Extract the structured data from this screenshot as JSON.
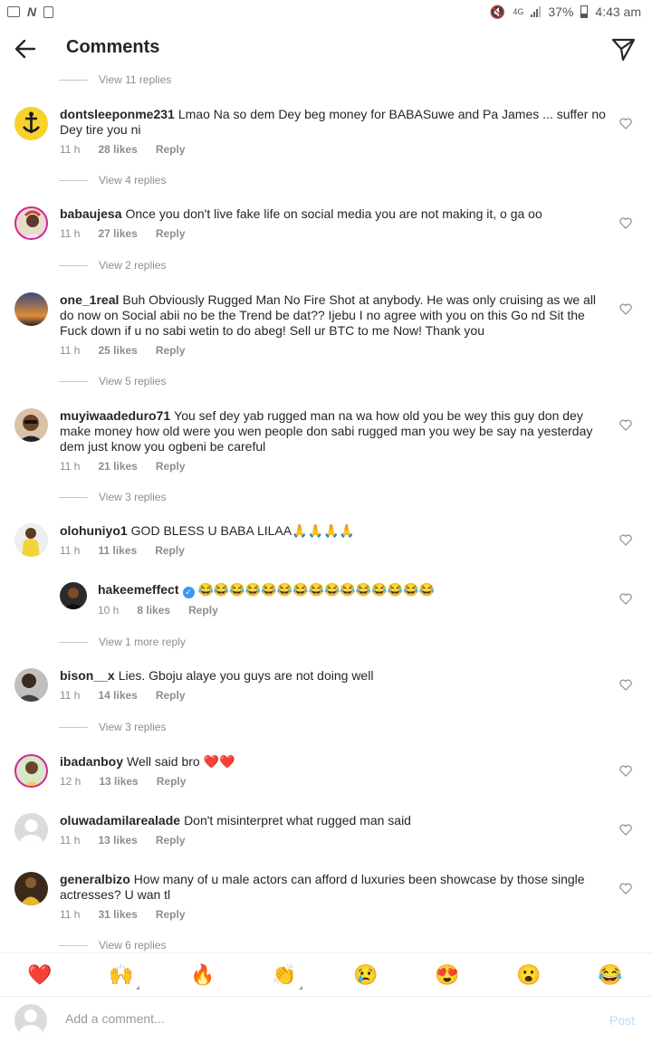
{
  "status_bar": {
    "battery": "37%",
    "time": "4:43 am",
    "network": "4G"
  },
  "header": {
    "title": "Comments"
  },
  "colors": {
    "heart_red": "#ed4956",
    "link_blue": "#3897f0",
    "secondary_text": "#8e8e8e",
    "post_disabled": "#b2dffc"
  },
  "top_replies": "View 11 replies",
  "comments": [
    {
      "user": "dontsleeponme231",
      "text": "Lmao Na so dem Dey beg money for BABASuwe and Pa James ... suffer no Dey tire you ni",
      "time": "11 h",
      "likes": "28 likes",
      "reply": "Reply",
      "replies": "View 4 replies"
    },
    {
      "user": "babaujesa",
      "text": "Once you don't live fake life on social media you are not making it, o ga oo",
      "time": "11 h",
      "likes": "27 likes",
      "reply": "Reply",
      "replies": "View 2 replies"
    },
    {
      "user": "one_1real",
      "text": "Buh Obviously Rugged Man No Fire Shot at anybody. He was only cruising as we all do now on Social abii no be the Trend be dat?? Ijebu I no agree with you on this Go nd Sit the Fuck down if u no sabi wetin to do abeg! Sell ur BTC to me Now! Thank you",
      "time": "11 h",
      "likes": "25 likes",
      "reply": "Reply",
      "replies": "View 5 replies"
    },
    {
      "user": "muyiwaadeduro71",
      "text": "You sef dey yab rugged man na wa how old you be wey this guy don dey make money how old were you wen people don sabi rugged man you wey be say na yesterday dem just know you ogbeni be careful",
      "time": "11 h",
      "likes": "21 likes",
      "reply": "Reply",
      "replies": "View 3 replies"
    },
    {
      "user": "olohuniyo1",
      "text": "GOD BLESS U BABA LILAA🙏🙏🙏🙏",
      "time": "11 h",
      "likes": "11 likes",
      "reply": "Reply",
      "replies": ""
    },
    {
      "user": "bison__x",
      "text": "Lies. Gboju alaye you guys are not doing well",
      "time": "11 h",
      "likes": "14 likes",
      "reply": "Reply",
      "replies": "View 3 replies"
    },
    {
      "user": "ibadanboy",
      "text": "Well said bro ❤️❤️",
      "time": "12 h",
      "likes": "13 likes",
      "reply": "Reply",
      "replies": ""
    },
    {
      "user": "oluwadamilarealade",
      "text": "Don't misinterpret what rugged man said",
      "time": "11 h",
      "likes": "13 likes",
      "reply": "Reply",
      "replies": ""
    },
    {
      "user": "generalbizo",
      "text": "How many of u male actors can afford d luxuries been showcase by those single actresses? U wan tl",
      "time": "11 h",
      "likes": "31 likes",
      "reply": "Reply",
      "replies": "View 6 replies"
    }
  ],
  "nested_reply": {
    "user": "hakeemeffect",
    "text": "😂😂😂😂😂😂😂😂😂😂😂😂😂😂😂",
    "time": "10 h",
    "likes": "8 likes",
    "reply": "Reply",
    "more": "View 1 more reply"
  },
  "emoji_bar": [
    "❤️",
    "🙌",
    "🔥",
    "👏",
    "😢",
    "😍",
    "😮",
    "😂"
  ],
  "composer": {
    "placeholder": "Add a comment...",
    "post": "Post"
  }
}
